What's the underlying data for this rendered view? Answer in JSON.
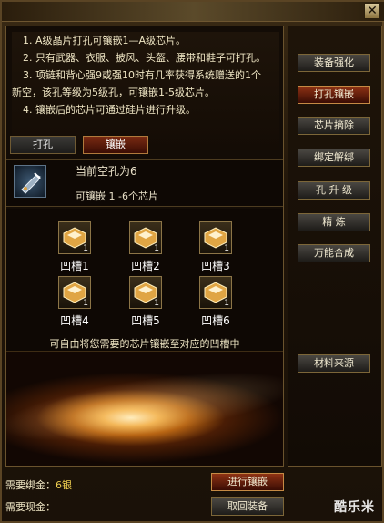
{
  "window": {
    "close_glyph": "✕"
  },
  "info_lines": [
    "1. A级晶片打孔可镶嵌1—A级芯片。",
    "2. 只有武器、衣服、披风、头盔、腰带和鞋子可打孔。",
    "3. 项链和背心强9或强10时有几率获得系统赠送的1个",
    "新空，该孔等级为5级孔，可镶嵌1-5级芯片。",
    "4. 镶嵌后的芯片可通过硅片进行升级。"
  ],
  "tabs": [
    {
      "label": "打孔",
      "active": false
    },
    {
      "label": "镶嵌",
      "active": true
    }
  ],
  "status": {
    "empty_holes": "当前空孔为6",
    "chip_range": "可镶嵌 1 -6个芯片"
  },
  "slots": [
    {
      "label": "凹槽1",
      "count": "1"
    },
    {
      "label": "凹槽2",
      "count": "1"
    },
    {
      "label": "凹槽3",
      "count": "1"
    },
    {
      "label": "凹槽4",
      "count": "1"
    },
    {
      "label": "凹槽5",
      "count": "1"
    },
    {
      "label": "凹槽6",
      "count": "1"
    }
  ],
  "hint": "可自由将您需要的芯片镶嵌至对应的凹槽中",
  "costs": {
    "bind_gold_label": "需要绑金：",
    "bind_gold_value": "6银",
    "cash_label": "需要现金：",
    "cash_value": ""
  },
  "actions": {
    "embed": "进行镶嵌",
    "retrieve": "取回装备"
  },
  "side_menu": [
    {
      "label": "装备强化",
      "active": false
    },
    {
      "label": "打孔镶嵌",
      "active": true
    },
    {
      "label": "芯片摘除",
      "active": false
    },
    {
      "label": "绑定解绑",
      "active": false
    },
    {
      "label": "孔 升 级",
      "active": false
    },
    {
      "label": "精    炼",
      "active": false
    },
    {
      "label": "万能合成",
      "active": false
    },
    {
      "label": "材料来源",
      "active": false
    }
  ],
  "watermark": "酷乐米",
  "colors": {
    "accent_red": "#8e3214",
    "gold_text": "#f0d050",
    "frame": "#6a532d"
  }
}
